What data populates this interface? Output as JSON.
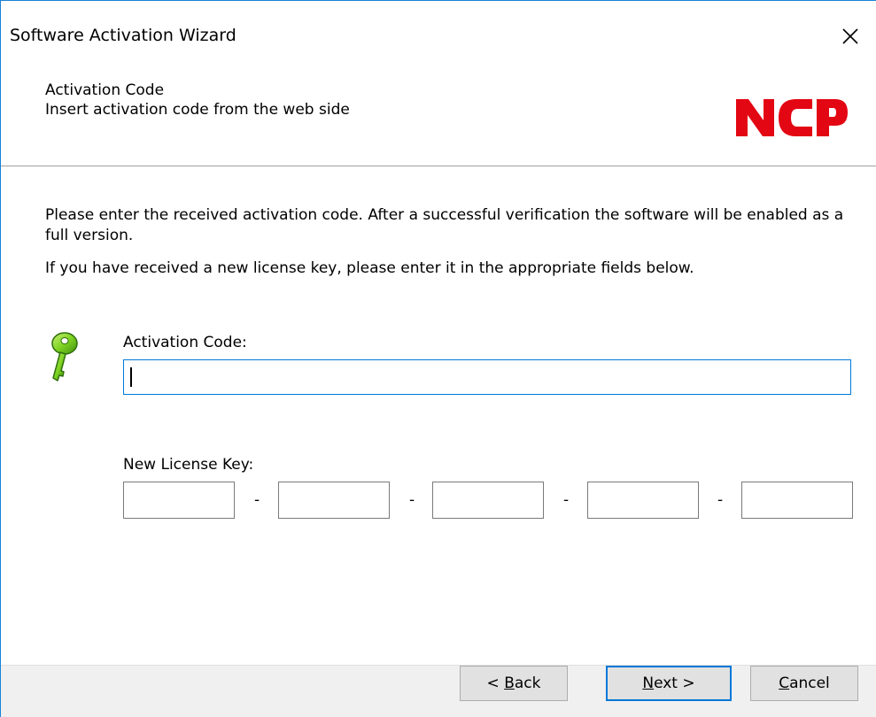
{
  "window": {
    "title": "Software Activation Wizard"
  },
  "header": {
    "title": "Activation Code",
    "subtitle": "Insert activation code from the web side",
    "logo_text": "NCP",
    "logo_color": "#e30613"
  },
  "content": {
    "paragraph1": "Please enter the received activation code. After a successful verification the software will be enabled as a full version.",
    "paragraph2": "If you have received a new license key, please enter it in the appropriate fields below.",
    "key_icon": "key-icon",
    "activation_code": {
      "label": "Activation Code:",
      "value": ""
    },
    "license_key": {
      "label": "New License Key:",
      "separator": "-",
      "fields": [
        "",
        "",
        "",
        "",
        ""
      ]
    }
  },
  "footer": {
    "back": {
      "mnemonic": "B",
      "rest": "ack",
      "prefix": "< "
    },
    "next": {
      "mnemonic": "N",
      "rest": "ext",
      "suffix": " >"
    },
    "cancel": {
      "mnemonic": "C",
      "rest": "ancel"
    }
  },
  "colors": {
    "accent": "#0078d7",
    "window_border": "#1883d7",
    "footer_bg": "#f0f0f0",
    "button_bg": "#e1e1e1",
    "key_green": "#7ed321"
  }
}
